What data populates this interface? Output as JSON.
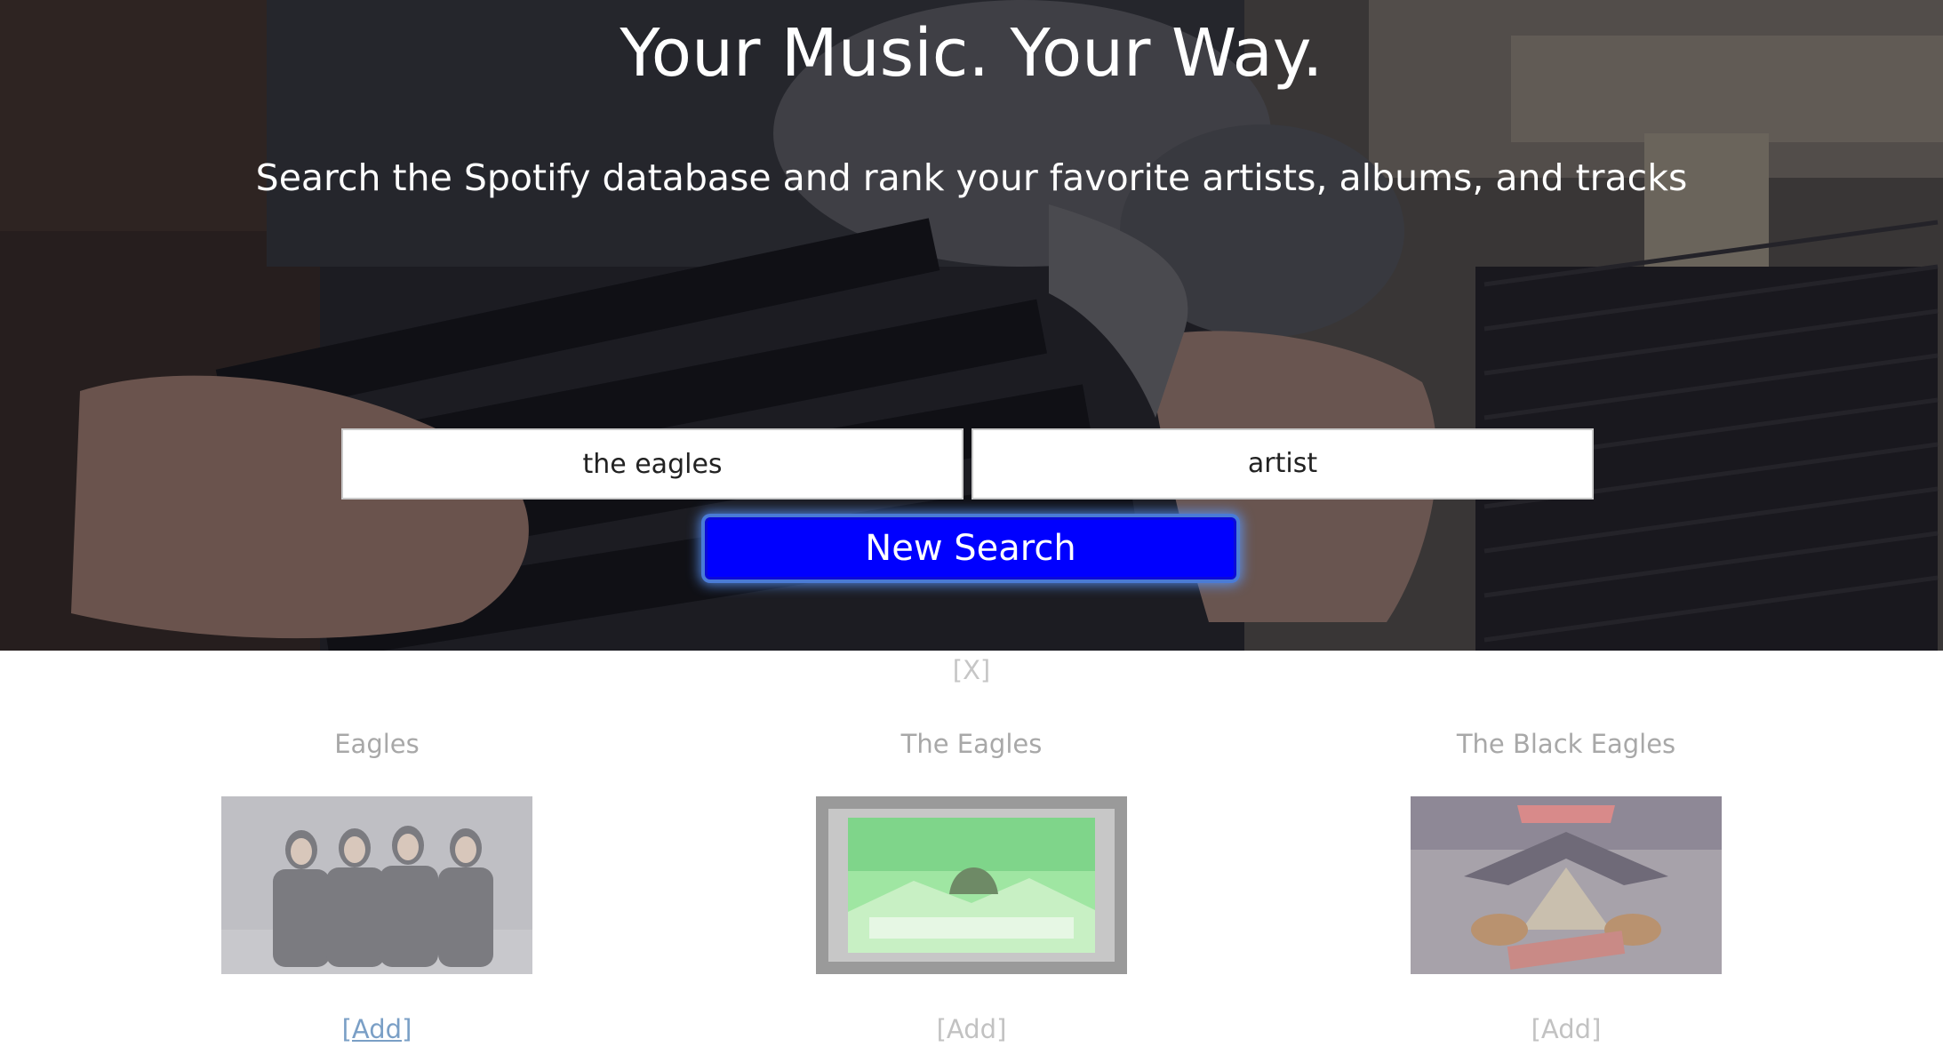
{
  "hero": {
    "headline": "Your Music. Your Way.",
    "tagline": "Search the Spotify database and rank your favorite artists, albums, and tracks",
    "background_label": "Record-crate photo"
  },
  "search": {
    "query_value": "the eagles",
    "type_value": "artist",
    "button_label": "New Search"
  },
  "results": {
    "close_label": "[X]",
    "items": [
      {
        "name": "Eagles",
        "image_label": "Band photo of four men",
        "add_label": "[Add]"
      },
      {
        "name": "The Eagles",
        "image_label": "The Eagles album cover",
        "add_label": "[Add]"
      },
      {
        "name": "The Black Eagles",
        "image_label": "The Black Eagles poster art",
        "add_label": "[Add]"
      }
    ]
  },
  "colors": {
    "button_blue": "#0000ff",
    "result_text": "#a8a8a8",
    "add_link": "#7a9fc6"
  }
}
